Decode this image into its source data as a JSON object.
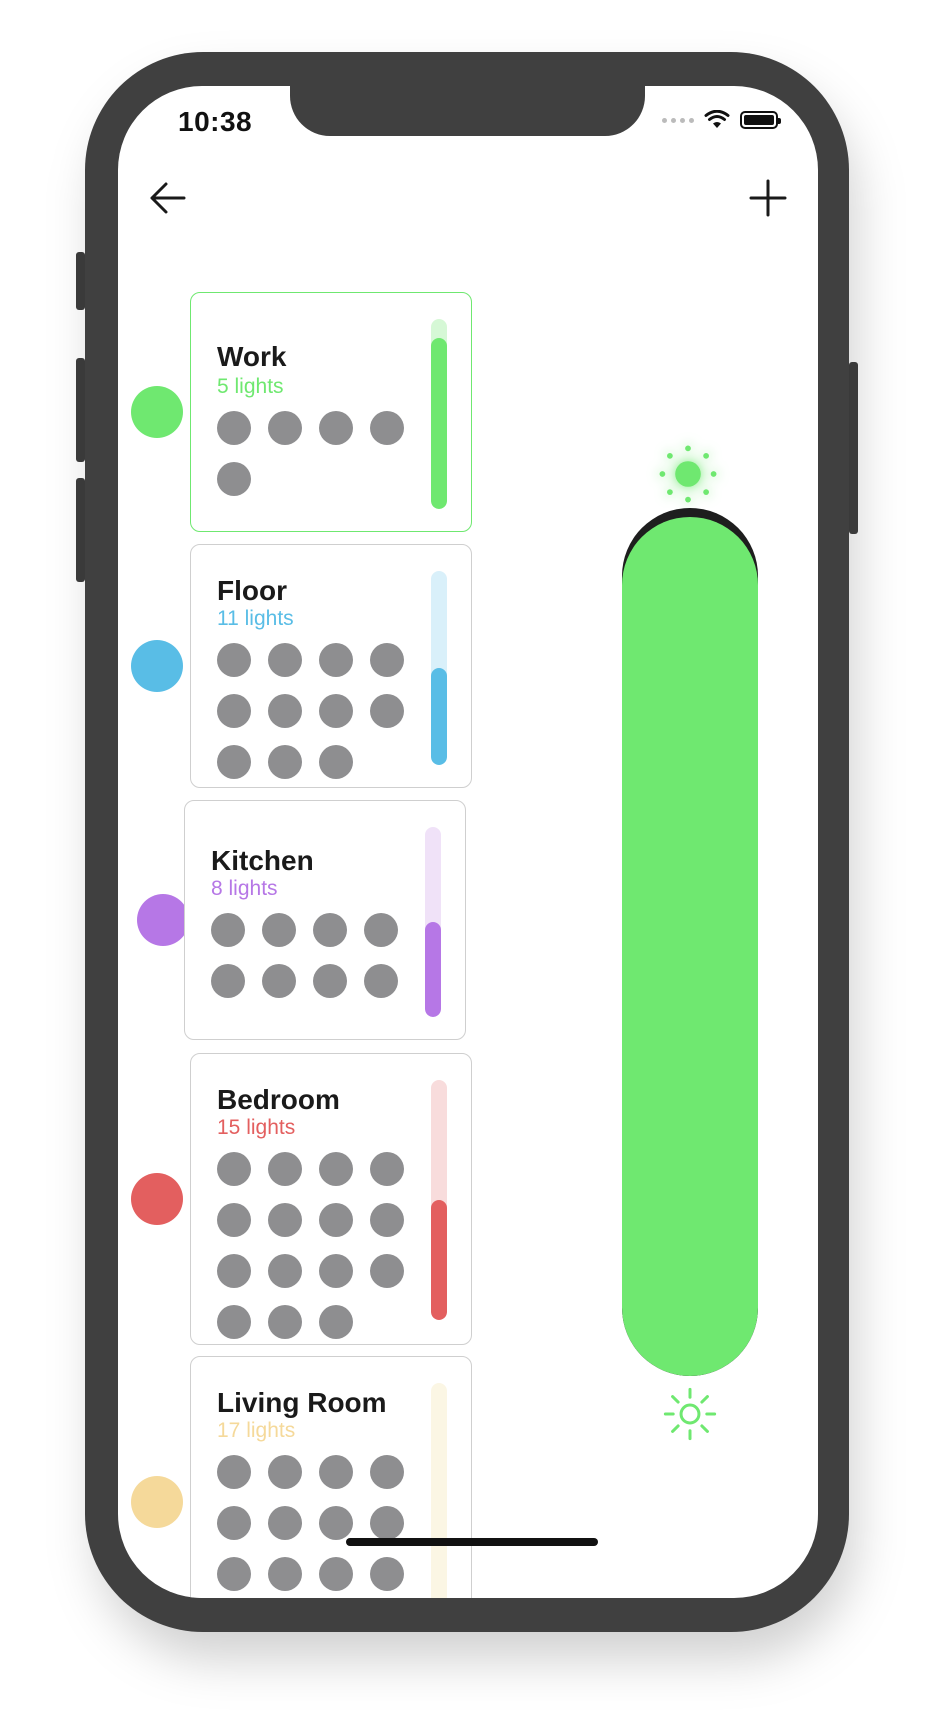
{
  "status_bar": {
    "time": "10:38"
  },
  "nav": {
    "back_icon": "arrow-left-icon",
    "add_icon": "plus-icon"
  },
  "rooms": [
    {
      "name": "Work",
      "lights_label": "5 lights",
      "light_count": 5,
      "color": "#6fe870",
      "track_color": "#d6f8d6",
      "level": 0.9,
      "selected": true
    },
    {
      "name": "Floor",
      "lights_label": "11 lights",
      "light_count": 11,
      "color": "#59bde6",
      "track_color": "#d9f0fa",
      "level": 0.5,
      "selected": false
    },
    {
      "name": "Kitchen",
      "lights_label": "8 lights",
      "light_count": 8,
      "color": "#b677e6",
      "track_color": "#f0e2f8",
      "level": 0.5,
      "selected": false
    },
    {
      "name": "Bedroom",
      "lights_label": "15 lights",
      "light_count": 15,
      "color": "#e35f5f",
      "track_color": "#f8dcdc",
      "level": 0.5,
      "selected": false
    },
    {
      "name": "Living Room",
      "lights_label": "17 lights",
      "light_count": 17,
      "color": "#f5d99a",
      "track_color": "#fbf6e4",
      "level": 0.5,
      "selected": false
    }
  ],
  "brightness": {
    "level": 0.99,
    "color": "#6fe870",
    "max_icon": "sun-filled-icon",
    "min_icon": "sun-outline-icon"
  }
}
